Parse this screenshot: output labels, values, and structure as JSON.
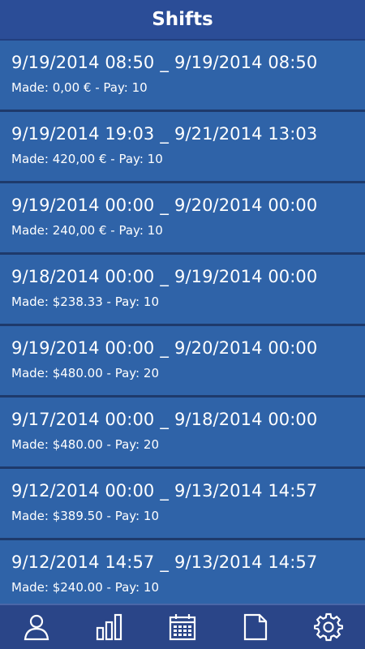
{
  "header": {
    "title": "Shifts"
  },
  "shifts": [
    {
      "start": "9/19/2014 08:50",
      "separator": "_",
      "end": "9/19/2014 08:50",
      "made_label": "Made:",
      "made": "0,00 €",
      "pay_label": "- Pay:",
      "pay": "10"
    },
    {
      "start": "9/19/2014 19:03",
      "separator": "_",
      "end": "9/21/2014 13:03",
      "made_label": "Made:",
      "made": "420,00 €",
      "pay_label": "- Pay:",
      "pay": "10"
    },
    {
      "start": "9/19/2014 00:00",
      "separator": "_",
      "end": "9/20/2014 00:00",
      "made_label": "Made:",
      "made": "240,00 €",
      "pay_label": "- Pay:",
      "pay": "10"
    },
    {
      "start": "9/18/2014 00:00",
      "separator": "_",
      "end": "9/19/2014 00:00",
      "made_label": "Made:",
      "made": "$238.33",
      "pay_label": "- Pay:",
      "pay": "10"
    },
    {
      "start": "9/19/2014 00:00",
      "separator": "_",
      "end": "9/20/2014 00:00",
      "made_label": "Made:",
      "made": "$480.00",
      "pay_label": "- Pay:",
      "pay": "20"
    },
    {
      "start": "9/17/2014 00:00",
      "separator": "_",
      "end": "9/18/2014 00:00",
      "made_label": "Made:",
      "made": "$480.00",
      "pay_label": "- Pay:",
      "pay": "20"
    },
    {
      "start": "9/12/2014 00:00",
      "separator": "_",
      "end": "9/13/2014 14:57",
      "made_label": "Made:",
      "made": "$389.50",
      "pay_label": "- Pay:",
      "pay": "10"
    },
    {
      "start": "9/12/2014 14:57",
      "separator": "_",
      "end": "9/13/2014 14:57",
      "made_label": "Made:",
      "made": "$240.00",
      "pay_label": "- Pay:",
      "pay": "10"
    }
  ],
  "tabbar": {
    "tabs": [
      {
        "icon": "user-icon"
      },
      {
        "icon": "bar-chart-icon"
      },
      {
        "icon": "calendar-icon"
      },
      {
        "icon": "document-icon"
      },
      {
        "icon": "gear-icon"
      }
    ]
  },
  "colors": {
    "header_bg": "#2b4d97",
    "row_bg": "#2f63a8",
    "row_divider": "#1e3a6b",
    "tabbar_bg": "#2a4588",
    "text": "#ffffff"
  }
}
